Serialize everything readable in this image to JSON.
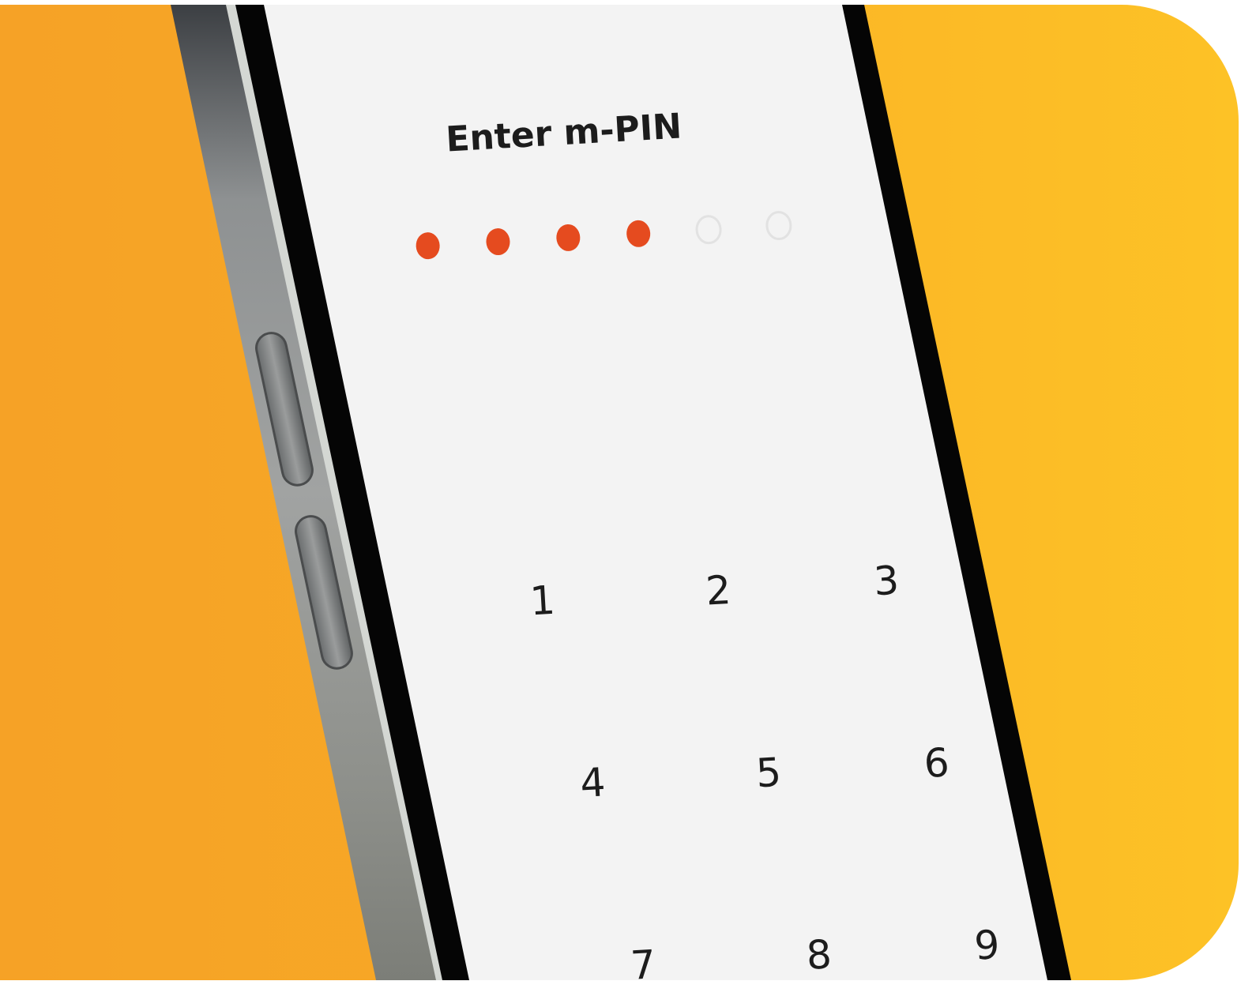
{
  "screen": {
    "title": "Enter m-PIN"
  },
  "pin": {
    "length": 6,
    "filled": 4,
    "filled_color": "#e54b1f",
    "empty_color": "#e2e2e2"
  },
  "keypad": {
    "keys": [
      "1",
      "2",
      "3",
      "4",
      "5",
      "6",
      "7",
      "8",
      "9"
    ]
  },
  "colors": {
    "background_left": "#f6a226",
    "background_right": "#fdc226",
    "screen_bg": "#f3f3f3",
    "bezel": "#050505",
    "frame": "#8f918e"
  }
}
